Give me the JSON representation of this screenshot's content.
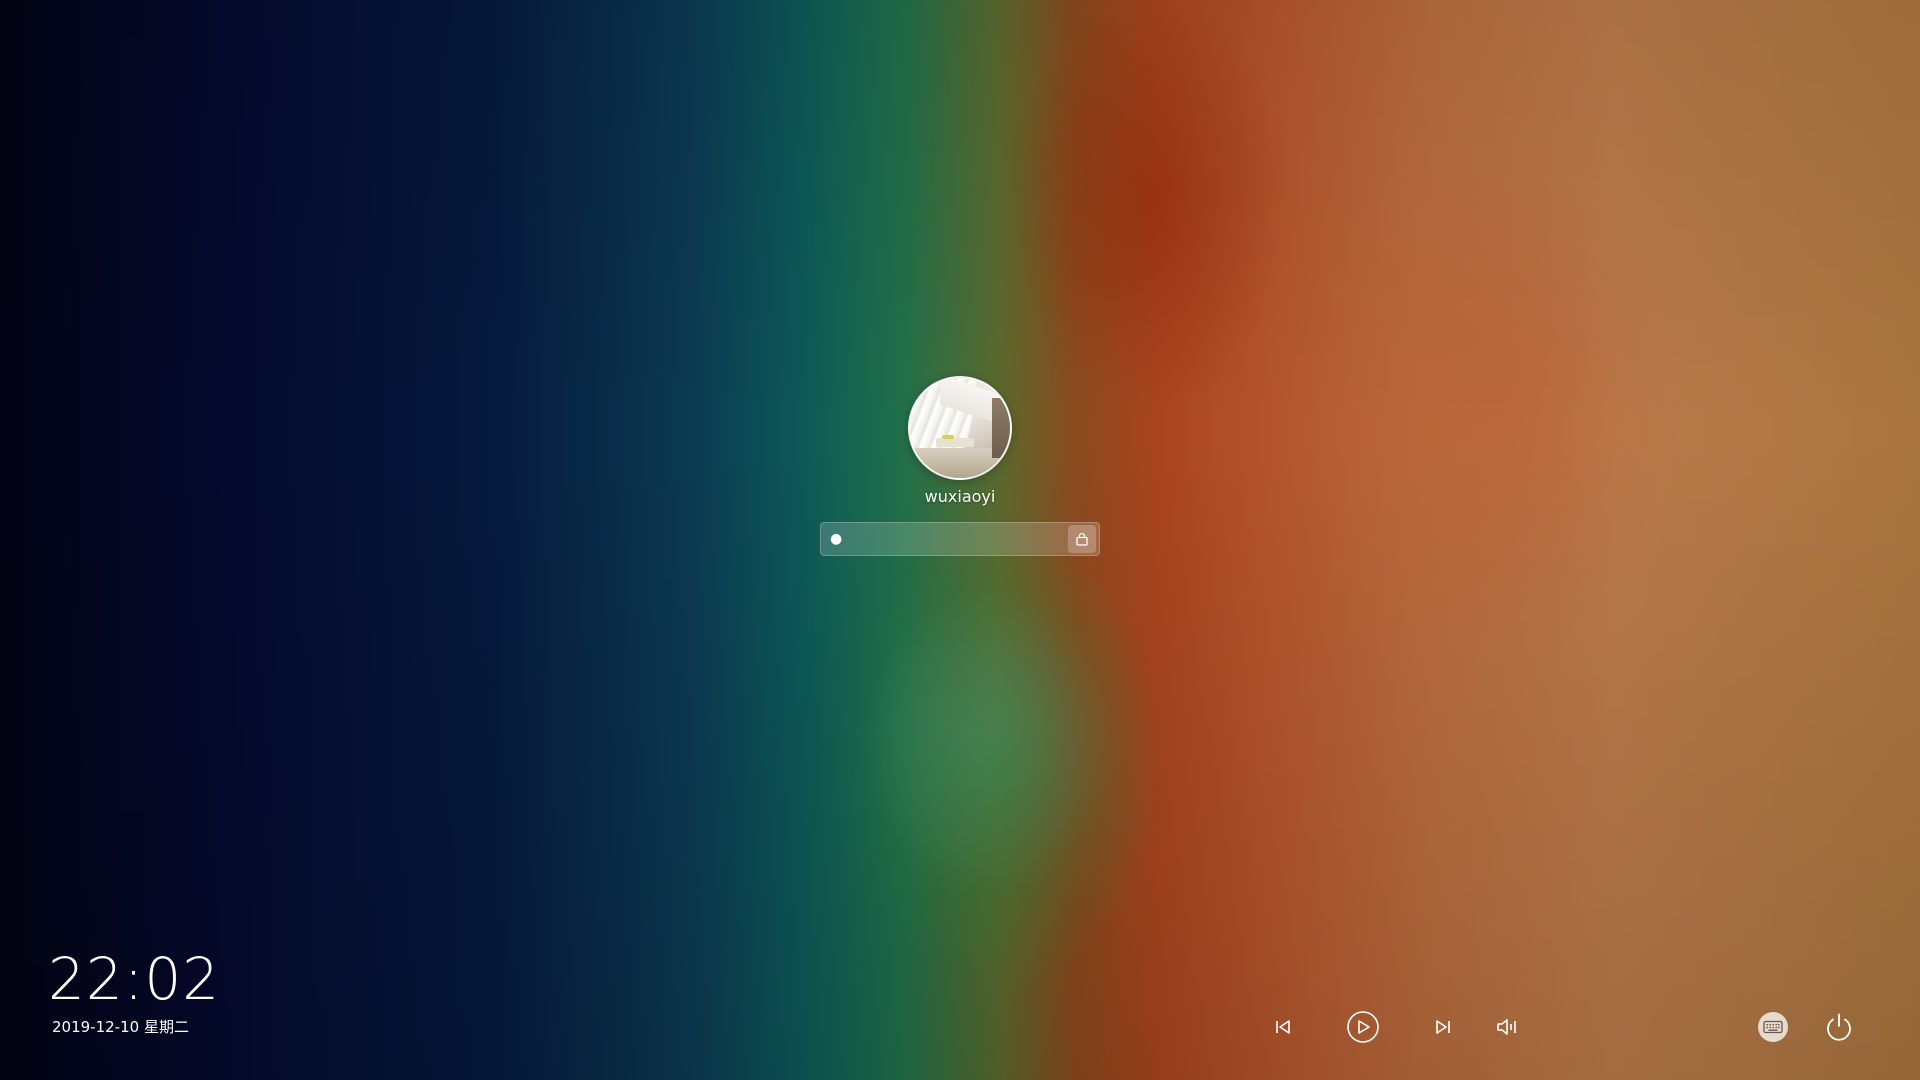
{
  "user": {
    "username": "wuxiaoyi",
    "avatar_icon": "avatar-photo-icon"
  },
  "password": {
    "masked_value": "●",
    "unlock_icon": "lock-icon"
  },
  "clock": {
    "time": "22:02",
    "date": "2019-12-10 星期二"
  },
  "media_controls": {
    "previous_icon": "skip-previous-icon",
    "play_icon": "play-icon",
    "next_icon": "skip-next-icon",
    "volume_icon": "volume-icon"
  },
  "system_controls": {
    "keyboard_icon": "keyboard-icon",
    "power_icon": "power-icon"
  },
  "colors": {
    "text": "#ffffff",
    "field_bg": "rgba(255,255,255,0.18)"
  }
}
